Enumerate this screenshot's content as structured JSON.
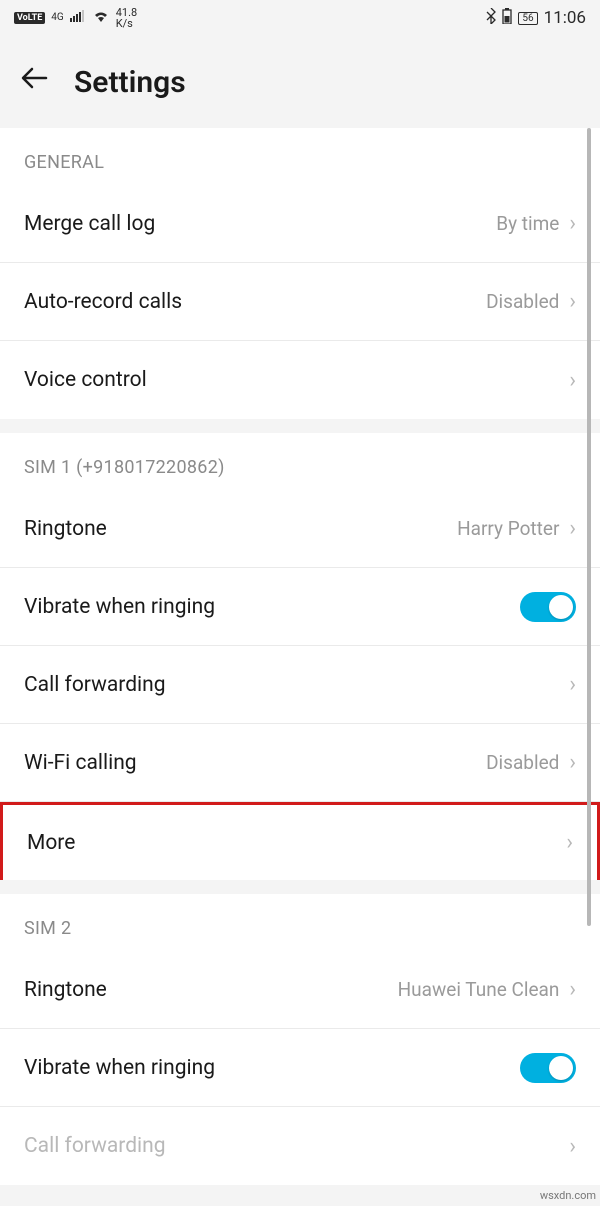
{
  "status": {
    "volte": "VoLTE",
    "net_4g": "4G",
    "speed_top": "41.8",
    "speed_bottom": "K/s",
    "battery": "56",
    "time": "11:06"
  },
  "header": {
    "title": "Settings"
  },
  "sections": {
    "general": {
      "title": "GENERAL",
      "merge_call_log": {
        "label": "Merge call log",
        "value": "By time"
      },
      "auto_record": {
        "label": "Auto-record calls",
        "value": "Disabled"
      },
      "voice_control": {
        "label": "Voice control"
      }
    },
    "sim1": {
      "title": "SIM 1 (+918017220862)",
      "ringtone": {
        "label": "Ringtone",
        "value": "Harry Potter"
      },
      "vibrate": {
        "label": "Vibrate when ringing",
        "on": true
      },
      "call_forwarding": {
        "label": "Call forwarding"
      },
      "wifi_calling": {
        "label": "Wi-Fi calling",
        "value": "Disabled"
      },
      "more": {
        "label": "More"
      }
    },
    "sim2": {
      "title": "SIM 2",
      "ringtone": {
        "label": "Ringtone",
        "value": "Huawei Tune Clean"
      },
      "vibrate": {
        "label": "Vibrate when ringing",
        "on": true
      },
      "call_forwarding": {
        "label": "Call forwarding"
      }
    }
  },
  "watermark": "wsxdn.com"
}
